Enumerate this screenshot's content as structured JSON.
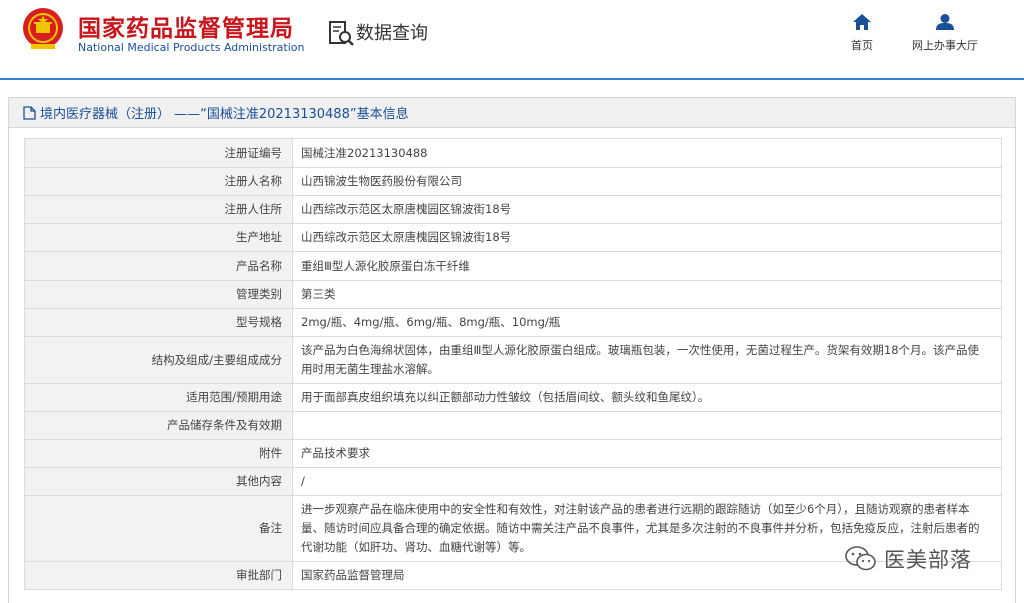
{
  "header": {
    "site_name": "国家药品监督管理局",
    "site_name_en": "National Medical Products Administration",
    "query_title": "数据查询",
    "nav": [
      {
        "label": "首页",
        "icon": "home-icon"
      },
      {
        "label": "网上办事大厅",
        "icon": "user-icon"
      }
    ],
    "colors": {
      "brand_red": "#c8161d",
      "brand_blue": "#1a4f99",
      "accent_line": "#2f7fd6"
    }
  },
  "panel": {
    "title": "境内医疗器械（注册） ——“国械注准20213130488”基本信息"
  },
  "rows": [
    {
      "label": "注册证编号",
      "value": "国械注准20213130488"
    },
    {
      "label": "注册人名称",
      "value": "山西锦波生物医药股份有限公司"
    },
    {
      "label": "注册人住所",
      "value": "山西综改示范区太原唐槐园区锦波街18号"
    },
    {
      "label": "生产地址",
      "value": "山西综改示范区太原唐槐园区锦波街18号"
    },
    {
      "label": "产品名称",
      "value": "重组Ⅲ型人源化胶原蛋白冻干纤维"
    },
    {
      "label": "管理类别",
      "value": "第三类"
    },
    {
      "label": "型号规格",
      "value": "2mg/瓶、4mg/瓶、6mg/瓶、8mg/瓶、10mg/瓶"
    },
    {
      "label": "结构及组成/主要组成成分",
      "value": "该产品为白色海绵状固体，由重组Ⅲ型人源化胶原蛋白组成。玻璃瓶包装，一次性使用，无菌过程生产。货架有效期18个月。该产品使用时用无菌生理盐水溶解。"
    },
    {
      "label": "适用范围/预期用途",
      "value": "用于面部真皮组织填充以纠正额部动力性皱纹（包括眉间纹、额头纹和鱼尾纹）。"
    },
    {
      "label": "产品储存条件及有效期",
      "value": ""
    },
    {
      "label": "附件",
      "value": "产品技术要求"
    },
    {
      "label": "其他内容",
      "value": "/"
    },
    {
      "label": "备注",
      "value": "进一步观察产品在临床使用中的安全性和有效性，对注射该产品的患者进行远期的跟踪随访（如至少6个月），且随访观察的患者样本量、随访时间应具备合理的确定依据。随访中需关注产品不良事件，尤其是多次注射的不良事件并分析，包括免疫反应，注射后患者的代谢功能（如肝功、肾功、血糖代谢等）等。"
    },
    {
      "label": "审批部门",
      "value": "国家药品监督管理局"
    }
  ],
  "watermark": {
    "text": "医美部落",
    "icon": "wechat-icon"
  }
}
